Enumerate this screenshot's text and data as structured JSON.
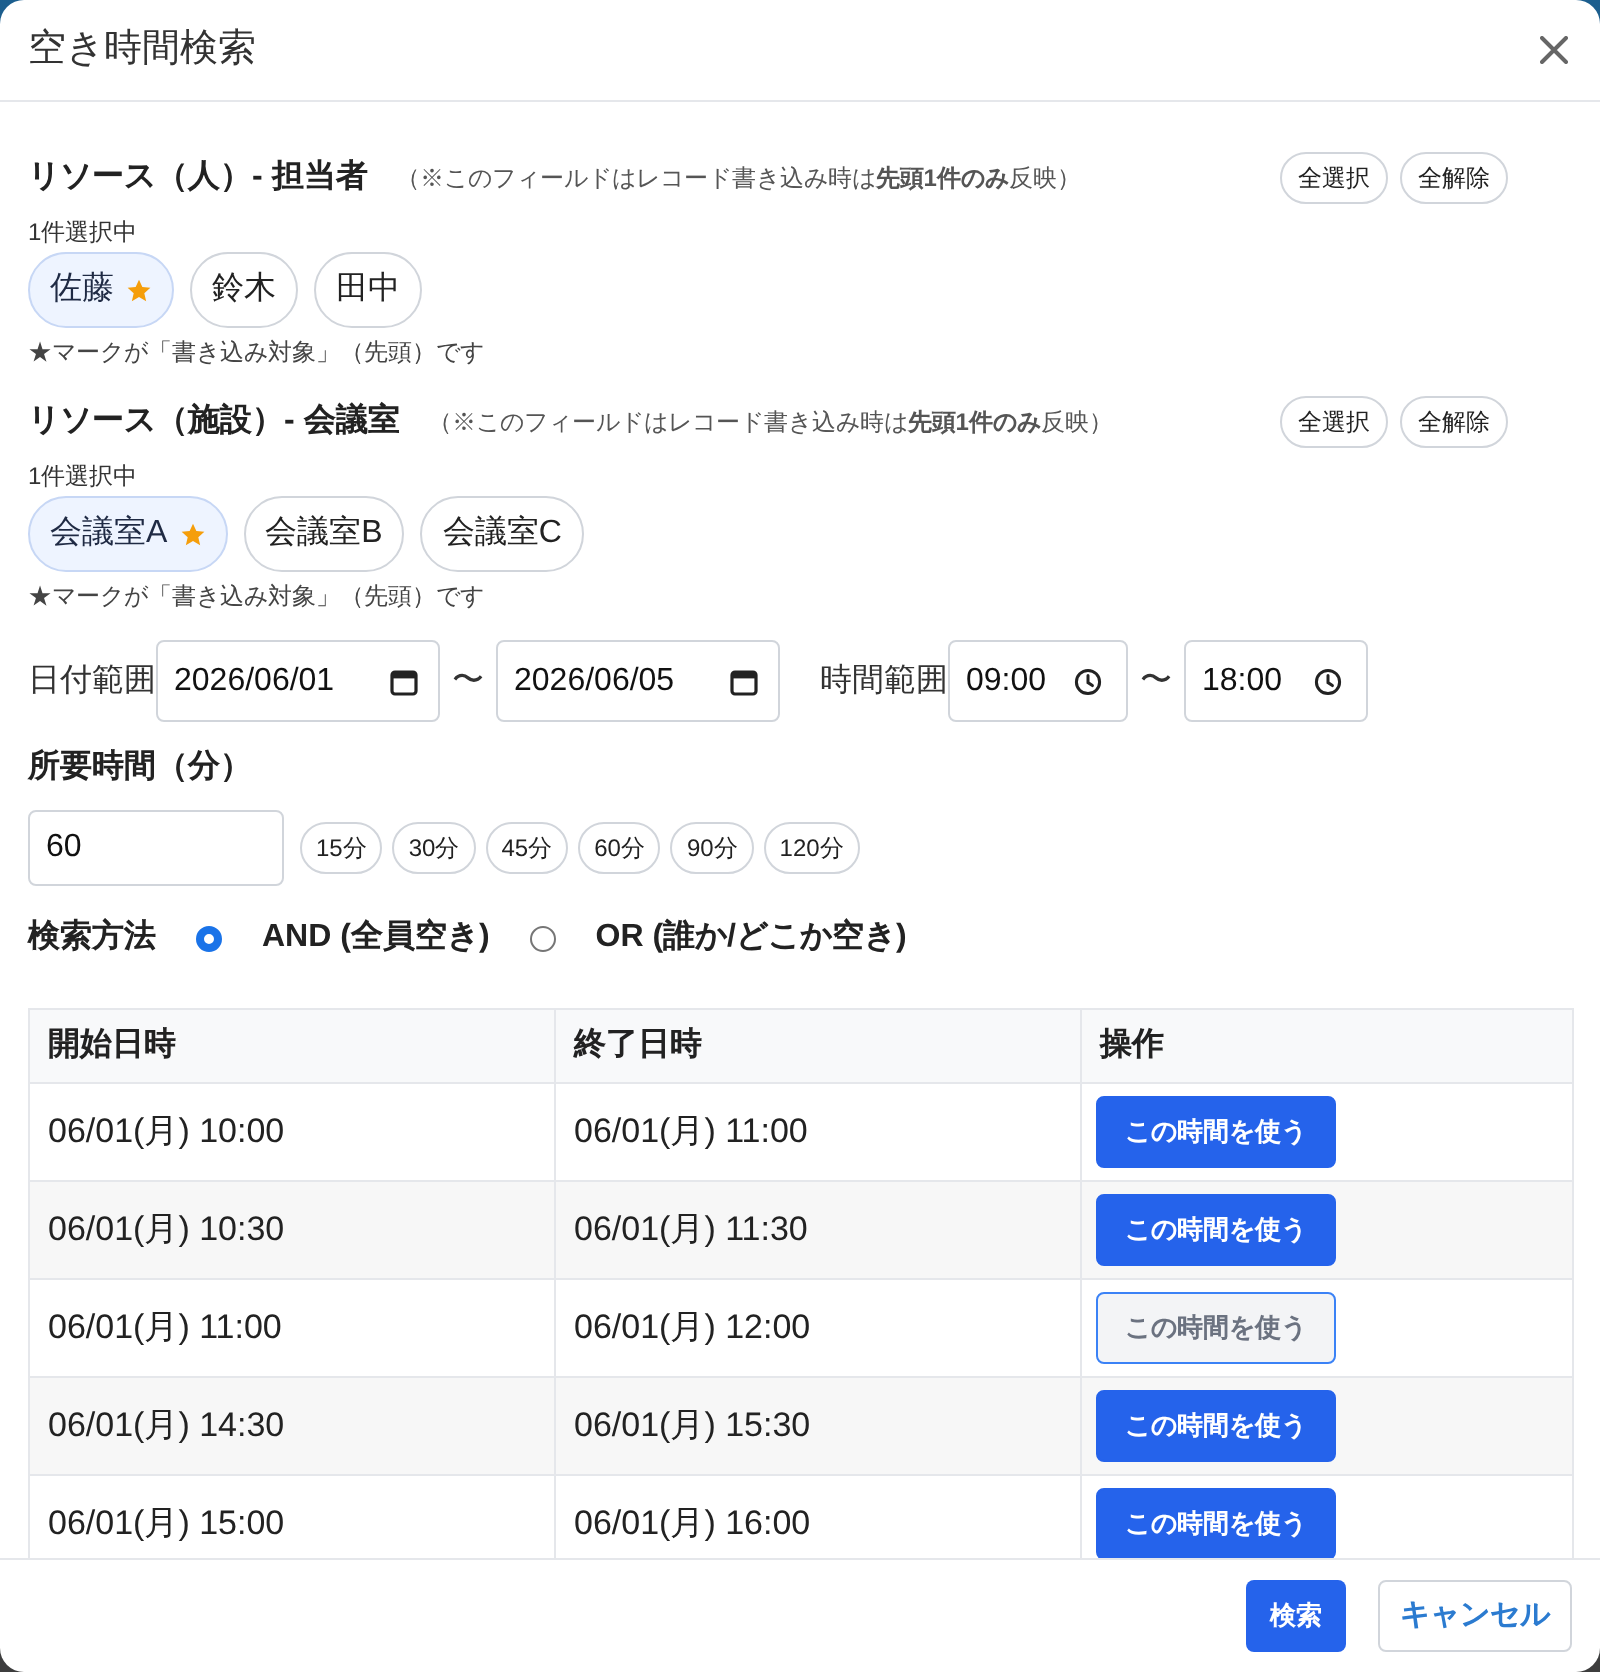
{
  "dialog": {
    "title": "空き時間検索"
  },
  "resource_sections": [
    {
      "heading": "リソース（人）- 担当者",
      "note": "（※このフィールドはレコード書き込み時は**先頭1件のみ**反映）",
      "buttons": [
        "全選択",
        "全解除"
      ],
      "count": "1件選択中",
      "chips": [
        {
          "label": "佐藤",
          "selected": true,
          "starred": true
        },
        {
          "label": "鈴木",
          "selected": false,
          "starred": false
        },
        {
          "label": "田中",
          "selected": false,
          "starred": false
        }
      ],
      "hint": "★マークが「書き込み対象」（先頭）です"
    },
    {
      "heading": "リソース（施設）- 会議室",
      "note": "（※このフィールドはレコード書き込み時は**先頭1件のみ**反映）",
      "buttons": [
        "全選択",
        "全解除"
      ],
      "count": "1件選択中",
      "chips": [
        {
          "label": "会議室A",
          "selected": true,
          "starred": true
        },
        {
          "label": "会議室B",
          "selected": false,
          "starred": false
        },
        {
          "label": "会議室C",
          "selected": false,
          "starred": false
        }
      ],
      "hint": "★マークが「書き込み対象」（先頭）です"
    }
  ],
  "date_range": {
    "label": "日付範囲",
    "from": "2026/06/01",
    "separator": "〜",
    "to": "2026/06/05"
  },
  "time_range": {
    "label": "時間範囲",
    "from": "09:00",
    "separator": "〜",
    "to": "18:00"
  },
  "duration": {
    "label": "所要時間（分）",
    "value": "60",
    "presets": [
      "15分",
      "30分",
      "45分",
      "60分",
      "90分",
      "120分"
    ]
  },
  "search_method": {
    "label": "検索方法",
    "options": [
      {
        "label": "AND (全員空き)",
        "selected": true
      },
      {
        "label": "OR (誰か/どこか空き)",
        "selected": false
      }
    ]
  },
  "table": {
    "columns": [
      "開始日時",
      "終了日時",
      "操作"
    ],
    "rows": [
      {
        "start": "06/01(月) 10:00",
        "end": "06/01(月) 11:00",
        "action": "この時間を使う",
        "focused": false
      },
      {
        "start": "06/01(月) 10:30",
        "end": "06/01(月) 11:30",
        "action": "この時間を使う",
        "focused": false
      },
      {
        "start": "06/01(月) 11:00",
        "end": "06/01(月) 12:00",
        "action": "この時間を使う",
        "focused": true
      },
      {
        "start": "06/01(月) 14:30",
        "end": "06/01(月) 15:30",
        "action": "この時間を使う",
        "focused": false
      },
      {
        "start": "06/01(月) 15:00",
        "end": "06/01(月) 16:00",
        "action": "この時間を使う",
        "focused": false
      }
    ]
  },
  "footer": {
    "buttons": [
      {
        "label": "検索",
        "kind": "primary"
      },
      {
        "label": "キャンセル",
        "kind": "secondary"
      }
    ]
  }
}
